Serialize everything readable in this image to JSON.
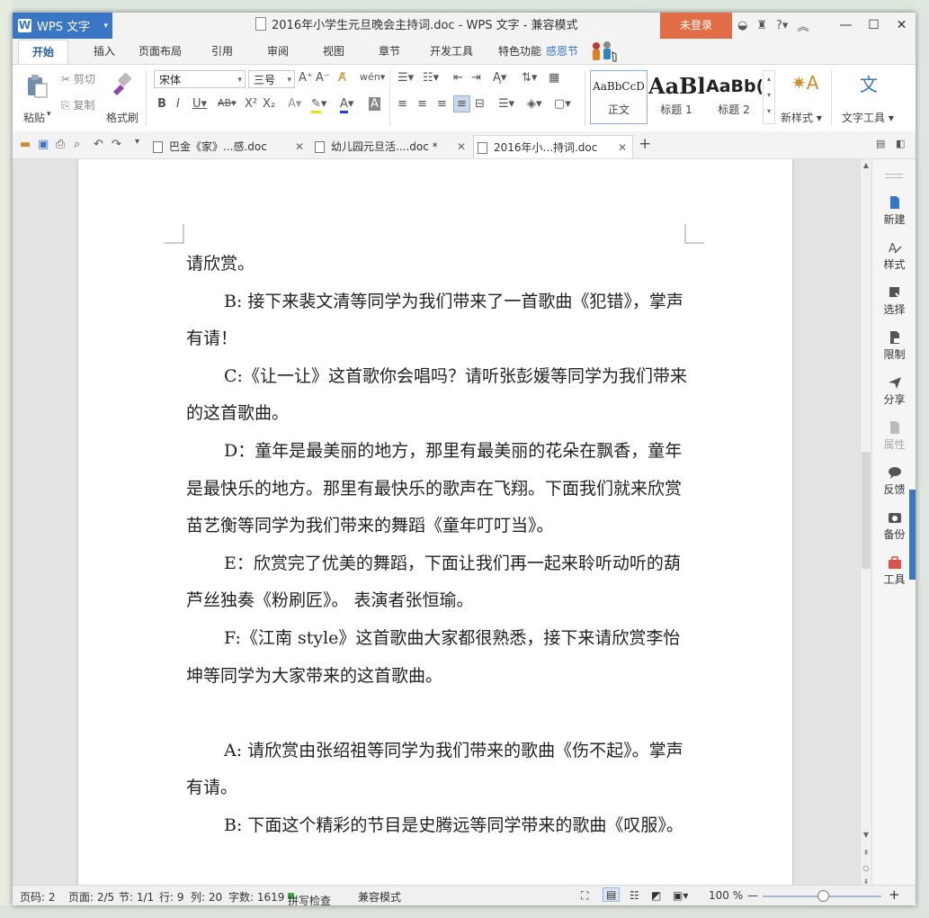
{
  "app": {
    "name": "WPS 文字",
    "logo_letter": "W"
  },
  "window": {
    "title": "2016年小学生元旦晚会主持词.doc - WPS 文字 - 兼容模式",
    "login_label": "未登录",
    "controls": {
      "minimize": "—",
      "restore": "☐",
      "close": "✕"
    }
  },
  "tabs": [
    "开始",
    "插入",
    "页面布局",
    "引用",
    "审阅",
    "视图",
    "章节",
    "开发工具",
    "特色功能",
    "感恩节"
  ],
  "ribbon": {
    "paste": "粘贴",
    "cut": "剪切",
    "copy": "复制",
    "format_painter": "格式刷",
    "font_name": "宋体",
    "font_size": "三号",
    "styles": [
      {
        "sample": "AaBbCcD",
        "name": "正文"
      },
      {
        "sample": "AaBl",
        "name": "标题 1"
      },
      {
        "sample": "AaBb(",
        "name": "标题 2"
      }
    ],
    "new_style": "新样式",
    "text_tools": "文字工具"
  },
  "doc_tabs": [
    {
      "label": "巴金《家》...感.doc"
    },
    {
      "label": "幼儿园元旦活....doc *"
    },
    {
      "label": "2016年小...持词.doc"
    }
  ],
  "document": {
    "paragraphs": [
      {
        "text": "请欣赏。",
        "indent": false
      },
      {
        "text": "B: 接下来裴文清等同学为我们带来了一首歌曲《犯错》，掌声有请！",
        "indent": true
      },
      {
        "text": "C:《让一让》这首歌你会唱吗？请听张彭媛等同学为我们带来的这首歌曲。",
        "indent": true
      },
      {
        "text": "D：童年是最美丽的地方，那里有最美丽的花朵在飘香，童年是最快乐的地方。那里有最快乐的歌声在飞翔。下面我们就来欣赏苗艺衡等同学为我们带来的舞蹈《童年叮叮当》。",
        "indent": true
      },
      {
        "text": "E：欣赏完了优美的舞蹈，下面让我们再一起来聆听动听的葫芦丝独奏《粉刷匠》。 表演者张恒瑜。",
        "indent": true
      },
      {
        "text": "F:《江南 style》这首歌曲大家都很熟悉，接下来请欣赏李怡坤等同学为大家带来的这首歌曲。",
        "indent": true
      },
      {
        "text": "",
        "indent": false
      },
      {
        "text": "A: 请欣赏由张绍祖等同学为我们带来的歌曲《伤不起》。掌声有请。",
        "indent": true
      },
      {
        "text": "B: 下面这个精彩的节目是史腾远等同学带来的歌曲《叹服》。",
        "indent": true
      }
    ]
  },
  "side_panel": [
    "新建",
    "样式",
    "选择",
    "限制",
    "分享",
    "属性",
    "反馈",
    "备份",
    "工具"
  ],
  "status_bar": {
    "page_num": "页码: 2",
    "pages": "页面: 2/5",
    "section": "节: 1/1",
    "row": "行: 9",
    "col": "列: 20",
    "words": "字数: 1619",
    "spell_check": "拼写检查",
    "mode": "兼容模式",
    "zoom": "100 %"
  }
}
